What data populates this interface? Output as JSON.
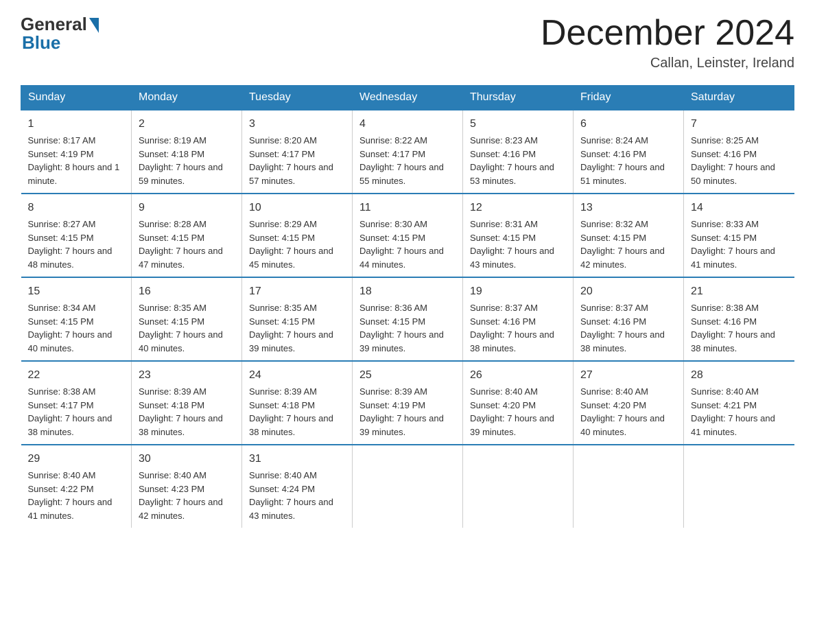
{
  "header": {
    "logo_general": "General",
    "logo_blue": "Blue",
    "month_title": "December 2024",
    "location": "Callan, Leinster, Ireland"
  },
  "days_of_week": [
    "Sunday",
    "Monday",
    "Tuesday",
    "Wednesday",
    "Thursday",
    "Friday",
    "Saturday"
  ],
  "weeks": [
    [
      {
        "day": "1",
        "sunrise": "8:17 AM",
        "sunset": "4:19 PM",
        "daylight": "8 hours and 1 minute."
      },
      {
        "day": "2",
        "sunrise": "8:19 AM",
        "sunset": "4:18 PM",
        "daylight": "7 hours and 59 minutes."
      },
      {
        "day": "3",
        "sunrise": "8:20 AM",
        "sunset": "4:17 PM",
        "daylight": "7 hours and 57 minutes."
      },
      {
        "day": "4",
        "sunrise": "8:22 AM",
        "sunset": "4:17 PM",
        "daylight": "7 hours and 55 minutes."
      },
      {
        "day": "5",
        "sunrise": "8:23 AM",
        "sunset": "4:16 PM",
        "daylight": "7 hours and 53 minutes."
      },
      {
        "day": "6",
        "sunrise": "8:24 AM",
        "sunset": "4:16 PM",
        "daylight": "7 hours and 51 minutes."
      },
      {
        "day": "7",
        "sunrise": "8:25 AM",
        "sunset": "4:16 PM",
        "daylight": "7 hours and 50 minutes."
      }
    ],
    [
      {
        "day": "8",
        "sunrise": "8:27 AM",
        "sunset": "4:15 PM",
        "daylight": "7 hours and 48 minutes."
      },
      {
        "day": "9",
        "sunrise": "8:28 AM",
        "sunset": "4:15 PM",
        "daylight": "7 hours and 47 minutes."
      },
      {
        "day": "10",
        "sunrise": "8:29 AM",
        "sunset": "4:15 PM",
        "daylight": "7 hours and 45 minutes."
      },
      {
        "day": "11",
        "sunrise": "8:30 AM",
        "sunset": "4:15 PM",
        "daylight": "7 hours and 44 minutes."
      },
      {
        "day": "12",
        "sunrise": "8:31 AM",
        "sunset": "4:15 PM",
        "daylight": "7 hours and 43 minutes."
      },
      {
        "day": "13",
        "sunrise": "8:32 AM",
        "sunset": "4:15 PM",
        "daylight": "7 hours and 42 minutes."
      },
      {
        "day": "14",
        "sunrise": "8:33 AM",
        "sunset": "4:15 PM",
        "daylight": "7 hours and 41 minutes."
      }
    ],
    [
      {
        "day": "15",
        "sunrise": "8:34 AM",
        "sunset": "4:15 PM",
        "daylight": "7 hours and 40 minutes."
      },
      {
        "day": "16",
        "sunrise": "8:35 AM",
        "sunset": "4:15 PM",
        "daylight": "7 hours and 40 minutes."
      },
      {
        "day": "17",
        "sunrise": "8:35 AM",
        "sunset": "4:15 PM",
        "daylight": "7 hours and 39 minutes."
      },
      {
        "day": "18",
        "sunrise": "8:36 AM",
        "sunset": "4:15 PM",
        "daylight": "7 hours and 39 minutes."
      },
      {
        "day": "19",
        "sunrise": "8:37 AM",
        "sunset": "4:16 PM",
        "daylight": "7 hours and 38 minutes."
      },
      {
        "day": "20",
        "sunrise": "8:37 AM",
        "sunset": "4:16 PM",
        "daylight": "7 hours and 38 minutes."
      },
      {
        "day": "21",
        "sunrise": "8:38 AM",
        "sunset": "4:16 PM",
        "daylight": "7 hours and 38 minutes."
      }
    ],
    [
      {
        "day": "22",
        "sunrise": "8:38 AM",
        "sunset": "4:17 PM",
        "daylight": "7 hours and 38 minutes."
      },
      {
        "day": "23",
        "sunrise": "8:39 AM",
        "sunset": "4:18 PM",
        "daylight": "7 hours and 38 minutes."
      },
      {
        "day": "24",
        "sunrise": "8:39 AM",
        "sunset": "4:18 PM",
        "daylight": "7 hours and 38 minutes."
      },
      {
        "day": "25",
        "sunrise": "8:39 AM",
        "sunset": "4:19 PM",
        "daylight": "7 hours and 39 minutes."
      },
      {
        "day": "26",
        "sunrise": "8:40 AM",
        "sunset": "4:20 PM",
        "daylight": "7 hours and 39 minutes."
      },
      {
        "day": "27",
        "sunrise": "8:40 AM",
        "sunset": "4:20 PM",
        "daylight": "7 hours and 40 minutes."
      },
      {
        "day": "28",
        "sunrise": "8:40 AM",
        "sunset": "4:21 PM",
        "daylight": "7 hours and 41 minutes."
      }
    ],
    [
      {
        "day": "29",
        "sunrise": "8:40 AM",
        "sunset": "4:22 PM",
        "daylight": "7 hours and 41 minutes."
      },
      {
        "day": "30",
        "sunrise": "8:40 AM",
        "sunset": "4:23 PM",
        "daylight": "7 hours and 42 minutes."
      },
      {
        "day": "31",
        "sunrise": "8:40 AM",
        "sunset": "4:24 PM",
        "daylight": "7 hours and 43 minutes."
      },
      null,
      null,
      null,
      null
    ]
  ],
  "labels": {
    "sunrise": "Sunrise:",
    "sunset": "Sunset:",
    "daylight": "Daylight:"
  }
}
